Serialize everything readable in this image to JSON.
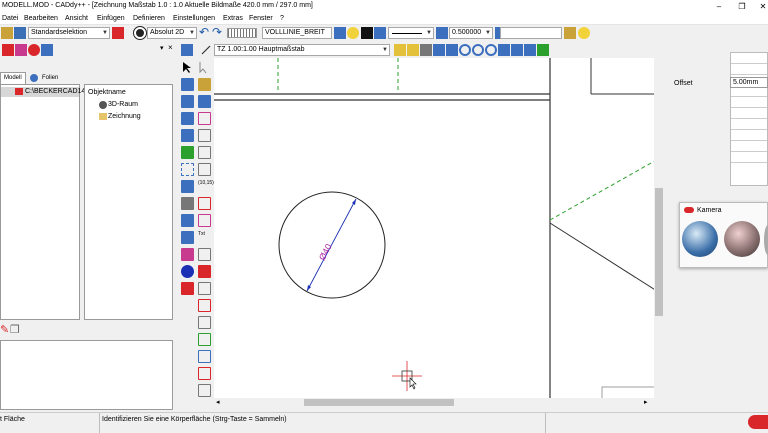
{
  "window": {
    "title": "MODELL.MOD - CADdy++ - [Zeichnung   Maßstab 1.0 : 1.0   Aktuelle Bildmaße 420.0 mm / 297.0 mm]"
  },
  "menu": [
    "Datei",
    "Bearbeiten",
    "Ansicht",
    "Einfügen",
    "Definieren",
    "Einstellungen",
    "Extras",
    "Fenster",
    "?"
  ],
  "toolbar": {
    "selection_mode": "Standardselektion",
    "coordinate_mode": "Absolut 2D",
    "line_type": "VOLLLINIE_BREIT",
    "line_width": "0.500000",
    "text_field": ""
  },
  "drawing_toolbar": {
    "scale_combo": "TZ 1.00:1.00 Hauptmaßstab"
  },
  "left_panel": {
    "tabs": [
      "Modell",
      "Folien"
    ],
    "tree_root": "C:\\BECKERCAD14",
    "objects_header": "Objektname",
    "objects": [
      "3D-Raum",
      "Zeichnung"
    ]
  },
  "drawing": {
    "dimension_label": "Ø40"
  },
  "right_panel": {
    "offset_label": "Offset",
    "offset_value": "5.00mm"
  },
  "camera_widget": {
    "title": "Kamera"
  },
  "statusbar": {
    "left_text": "t Fläche",
    "message": "Identifizieren Sie eine Körperfläche (Strg-Taste = Sammeln)"
  },
  "colors": {
    "accent_red": "#d9262a",
    "dim_magenta": "#b02aa8",
    "dim_blue": "#1b2fb5",
    "guide_green": "#2ca02c"
  }
}
